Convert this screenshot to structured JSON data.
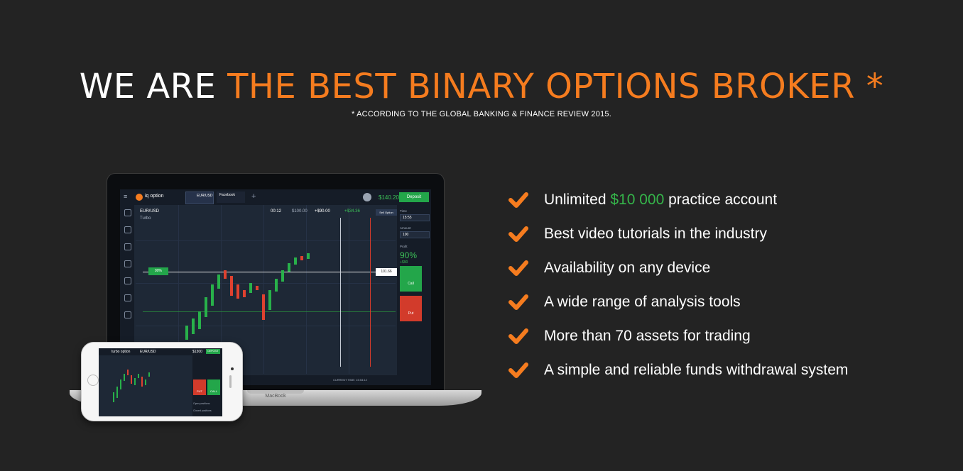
{
  "hero": {
    "title_white": "WE ARE",
    "title_accent": "THE BEST BINARY OPTIONS BROKER *",
    "footnote": "* ACCORDING TO THE GLOBAL BANKING & FINANCE REVIEW 2015."
  },
  "features": [
    {
      "before": "Unlimited ",
      "highlight": "$10 000",
      "after": " practice account"
    },
    {
      "before": "Best video tutorials in the industry",
      "highlight": "",
      "after": ""
    },
    {
      "before": "Availability on any device",
      "highlight": "",
      "after": ""
    },
    {
      "before": "A wide range of analysis tools",
      "highlight": "",
      "after": ""
    },
    {
      "before": "More than 70 assets for trading",
      "highlight": "",
      "after": ""
    },
    {
      "before": "A simple and reliable funds withdrawal system",
      "highlight": "",
      "after": ""
    }
  ],
  "laptop": {
    "brand": "MacBook",
    "logo": "iq option",
    "asset_tab": "EUR/USD",
    "asset_tab2": "Facebook",
    "balance": "$140.20",
    "deposit": "Deposit",
    "asset_name": "EUR/USD",
    "asset_type": "Turbo",
    "timer": "00:12",
    "invest": "$100.00",
    "payout": "+$90.00",
    "profit": "+$34.36",
    "sell": "Sell Option",
    "pct_tag": "90%",
    "price_tag": "101.66",
    "time_label": "Time",
    "time_value": "15:55",
    "amount_label": "Amount",
    "amount_value": "100",
    "profit_label": "Profit",
    "profit_pct": "90%",
    "profit_plus": "+$90",
    "call": "Call",
    "put": "Put",
    "current_time": "CURRENT TIME: 15:54:12"
  },
  "phone": {
    "logo": "turbo option",
    "asset": "EUR/USD",
    "balance": "$1300",
    "deposit": "DEPOSIT",
    "put": "PUT",
    "call": "CALL",
    "open_positions": "Open positions",
    "closed_positions": "Closed positions"
  },
  "colors": {
    "accent": "#f57c1f",
    "green": "#35b54a",
    "background": "#232323"
  }
}
